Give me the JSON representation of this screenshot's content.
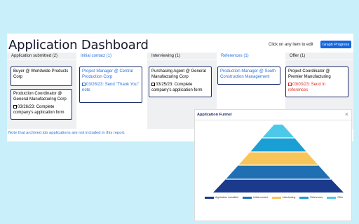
{
  "header": {
    "title": "Application Dashboard",
    "hint": "Click on any item to edit",
    "graph_button": "Graph Progress"
  },
  "columns": [
    {
      "label": "Application submitted (2)"
    },
    {
      "label": "Initial contact (1)"
    },
    {
      "label": "Interviewing (1)"
    },
    {
      "label": "References (1)"
    },
    {
      "label": "Offer (1)"
    }
  ],
  "cards": {
    "c1": {
      "title": "Buyer @ Worldwide Products Corp"
    },
    "c2": {
      "title": "Production Coordinator @ General Manufacturing Corp",
      "date": "03/26/23: Complete company's application form"
    },
    "c3": {
      "title": "Project Manager @ Central Production Corp",
      "date": "03/28/23: Send \"Thank You\" note"
    },
    "c4": {
      "title": "Purchasing Agent @ General Manufacturing Corp",
      "date": "03/25/23: Complete company's application form"
    },
    "c5": {
      "title": "Production Manager @ South Construction Management"
    },
    "c6": {
      "title": "Project Coordinator @ Premier Manufacturing",
      "date": "03/03/23: Send in references"
    }
  },
  "note": "Note that archived job applications are not included in this report.",
  "funnel": {
    "title": "Application Funnel",
    "close": "×",
    "stages": [
      {
        "name": "Application submitted",
        "color": "#1b3a8c"
      },
      {
        "name": "Initial contact",
        "color": "#1f6fb2"
      },
      {
        "name": "Interviewing",
        "color": "#f7c55a"
      },
      {
        "name": "References",
        "color": "#1a9fd4"
      },
      {
        "name": "Offer",
        "color": "#4cc9e8"
      }
    ]
  }
}
